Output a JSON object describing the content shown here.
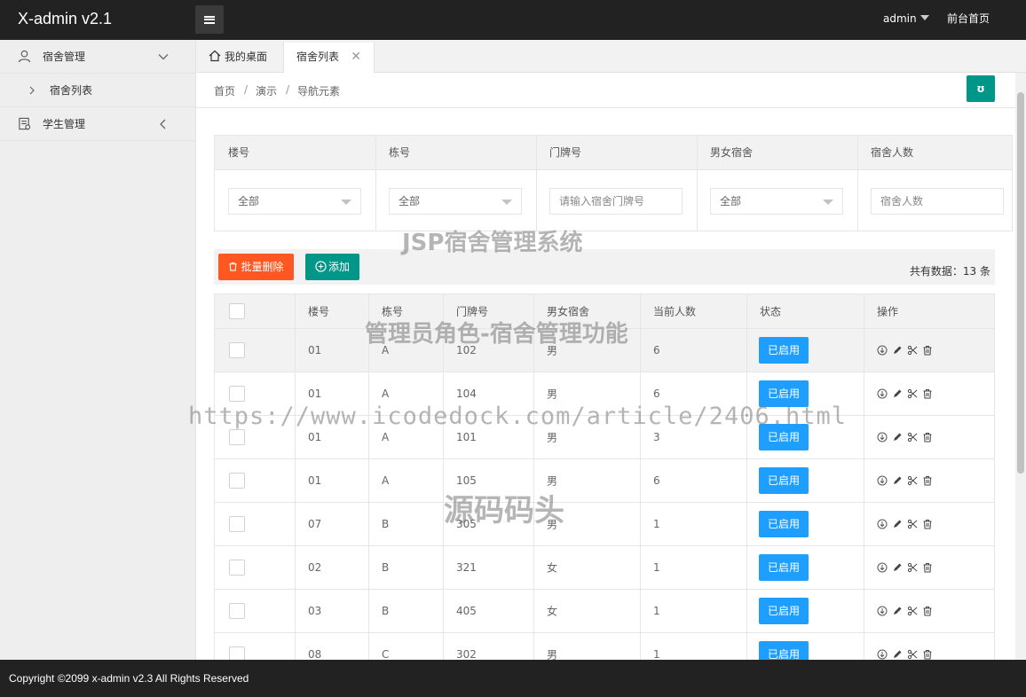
{
  "header": {
    "logo": "X-admin v2.1",
    "user": "admin",
    "front_link": "前台首页"
  },
  "sidebar": {
    "items": [
      {
        "label": "宿舍管理",
        "icon": "user-icon"
      },
      {
        "label": "宿舍列表",
        "icon": "chevron-right-icon"
      },
      {
        "label": "学生管理",
        "icon": "form-icon"
      }
    ]
  },
  "tabs": [
    {
      "label": "我的桌面",
      "icon": "home-icon"
    },
    {
      "label": "宿舍列表",
      "icon": "close-icon",
      "active": true
    }
  ],
  "breadcrumb": [
    "首页",
    "演示",
    "导航元素"
  ],
  "breadcrumb_sep": "/",
  "refresh_label": "ʊ",
  "filter": {
    "headers": [
      "楼号",
      "栋号",
      "门牌号",
      "男女宿舍",
      "宿舍人数"
    ],
    "building_value": "全部",
    "block_value": "全部",
    "door_placeholder": "请输入宿舍门牌号",
    "gender_value": "全部",
    "count_placeholder": "宿舍人数"
  },
  "toolbar": {
    "delete_label": "批量删除",
    "add_label": "添加",
    "total_text": "共有数据：13 条"
  },
  "table": {
    "columns": [
      "楼号",
      "栋号",
      "门牌号",
      "男女宿舍",
      "当前人数",
      "状态",
      "操作"
    ],
    "rows": [
      {
        "building": "01",
        "block": "A",
        "door": "102",
        "gender": "男",
        "count": "6",
        "status": "已启用"
      },
      {
        "building": "01",
        "block": "A",
        "door": "104",
        "gender": "男",
        "count": "6",
        "status": "已启用"
      },
      {
        "building": "01",
        "block": "A",
        "door": "101",
        "gender": "男",
        "count": "3",
        "status": "已启用"
      },
      {
        "building": "01",
        "block": "A",
        "door": "105",
        "gender": "男",
        "count": "6",
        "status": "已启用"
      },
      {
        "building": "07",
        "block": "B",
        "door": "305",
        "gender": "男",
        "count": "1",
        "status": "已启用"
      },
      {
        "building": "02",
        "block": "B",
        "door": "321",
        "gender": "女",
        "count": "1",
        "status": "已启用"
      },
      {
        "building": "03",
        "block": "B",
        "door": "405",
        "gender": "女",
        "count": "1",
        "status": "已启用"
      },
      {
        "building": "08",
        "block": "C",
        "door": "302",
        "gender": "男",
        "count": "1",
        "status": "已启用"
      }
    ]
  },
  "footer": "Copyright ©2099 x-admin v2.3 All Rights Reserved",
  "watermarks": [
    "JSP宿舍管理系统",
    "管理员角色-宿舍管理功能",
    "https://www.icodedock.com/article/2406.html",
    "源码码头"
  ],
  "colors": {
    "header_bg": "#222222",
    "danger": "#FF5722",
    "primary": "#009688",
    "status": "#1E9FFF"
  }
}
